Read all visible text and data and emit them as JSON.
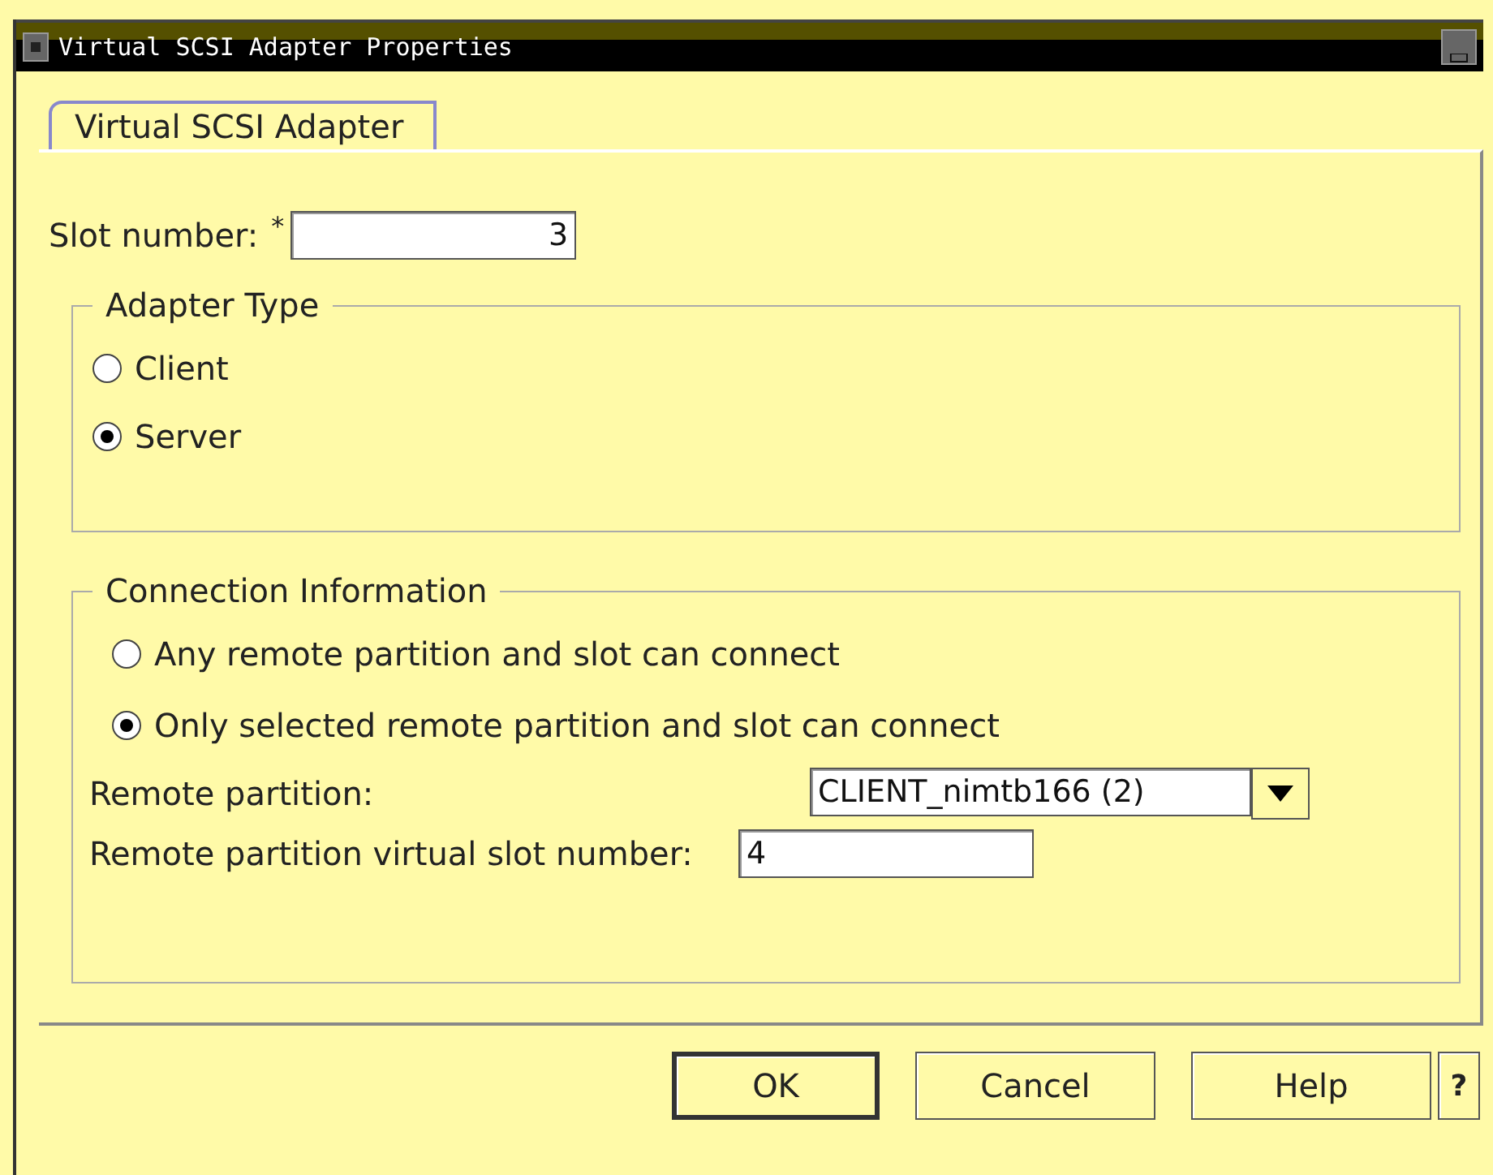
{
  "window": {
    "title": "Virtual SCSI Adapter Properties"
  },
  "tabs": [
    {
      "label": "Virtual SCSI Adapter",
      "selected": true
    }
  ],
  "slot_number": {
    "label": "Slot number:",
    "required_mark": "*",
    "value": "3"
  },
  "adapter_type": {
    "title": "Adapter Type",
    "options": [
      {
        "label": "Client",
        "selected": false
      },
      {
        "label": "Server",
        "selected": true
      }
    ]
  },
  "connection": {
    "title": "Connection Information",
    "options": [
      {
        "label": "Any remote partition and slot can connect",
        "selected": false
      },
      {
        "label": "Only selected remote partition and slot can connect",
        "selected": true
      }
    ],
    "remote_partition": {
      "label": "Remote partition:",
      "value": "CLIENT_nimtb166 (2)"
    },
    "remote_slot": {
      "label": "Remote partition virtual slot number:",
      "value": "4"
    }
  },
  "buttons": [
    {
      "label": "OK",
      "kind": "default"
    },
    {
      "label": "Cancel",
      "kind": "normal"
    },
    {
      "label": "Help",
      "kind": "normal"
    },
    {
      "label": "?",
      "kind": "small"
    }
  ]
}
